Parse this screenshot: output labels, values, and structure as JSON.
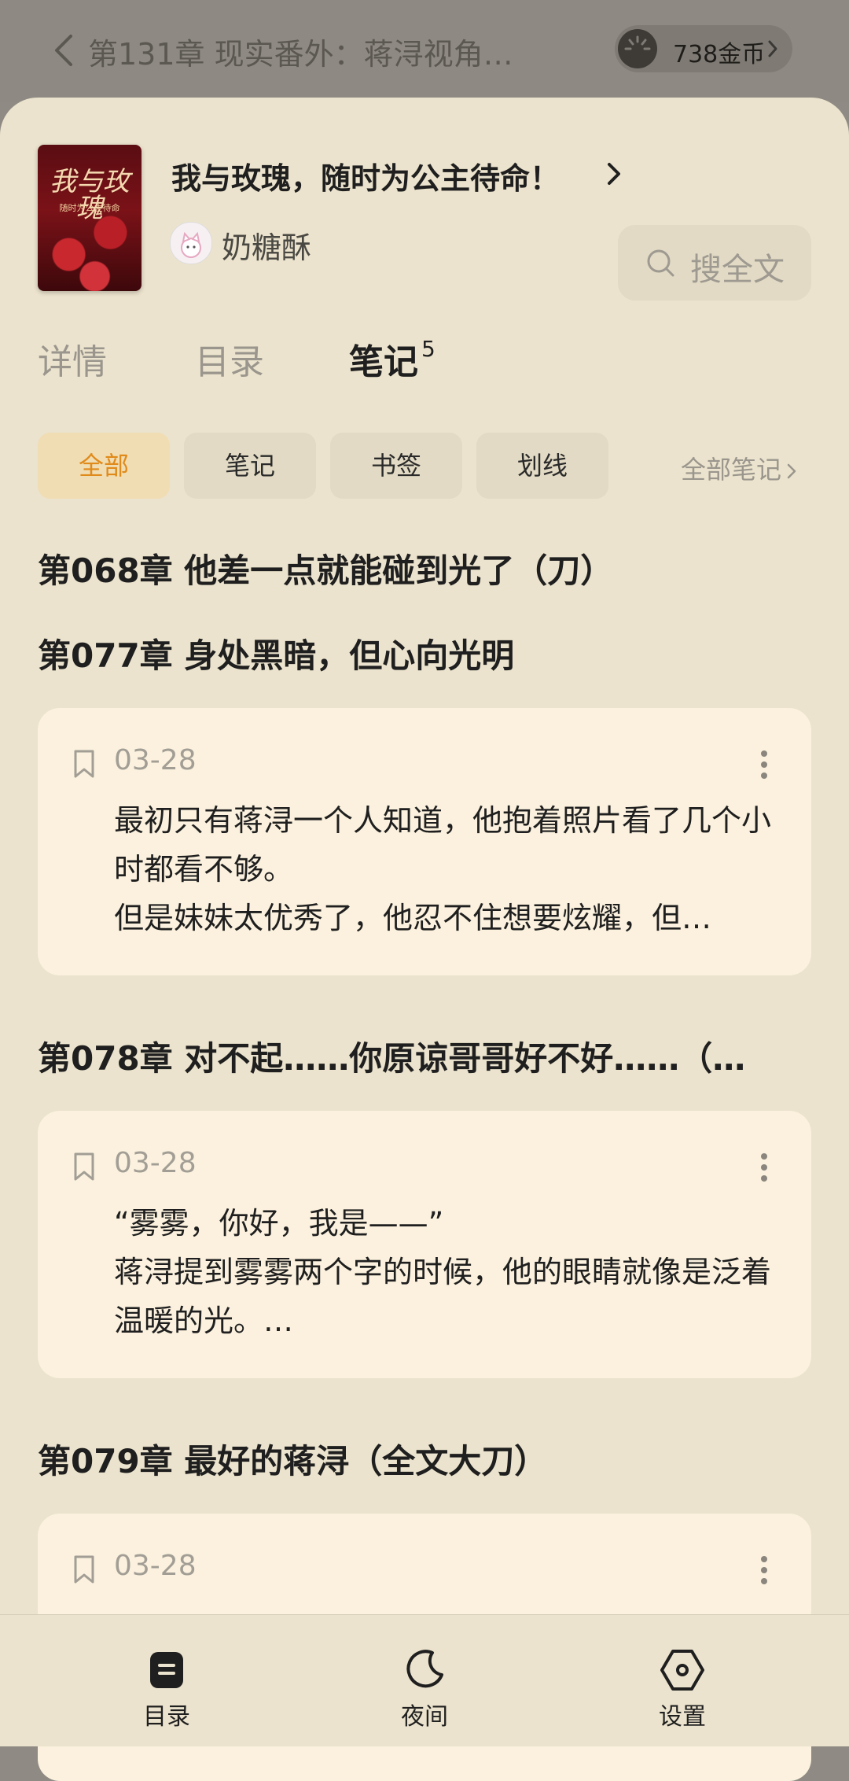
{
  "topbar": {
    "title": "第131章 现实番外：蒋浔视角…",
    "coins": "738金币"
  },
  "book": {
    "title": "我与玫瑰，随时为公主待命！",
    "author": "奶糖酥",
    "cover_title": "我与玫瑰",
    "cover_sub": "随时为公主待命"
  },
  "search": {
    "label": "搜全文"
  },
  "tabs": [
    {
      "label": "详情"
    },
    {
      "label": "目录"
    },
    {
      "label": "笔记",
      "count": "5"
    }
  ],
  "filters": [
    {
      "label": "全部",
      "active": true
    },
    {
      "label": "笔记"
    },
    {
      "label": "书签"
    },
    {
      "label": "划线"
    }
  ],
  "all_notes_label": "全部笔记",
  "chapters": [
    {
      "title": "第068章 他差一点就能碰到光了（刀）"
    },
    {
      "title": "第077章 身处黑暗，但心向光明"
    },
    {
      "title": "第078章 对不起……你原谅哥哥好不好……（…"
    },
    {
      "title": "第079章 最好的蒋浔（全文大刀）"
    }
  ],
  "notes": [
    {
      "date": "03-28",
      "text": "最初只有蒋浔一个人知道，他抱着照片看了几个小时都看不够。\n但是妹妹太优秀了，他忍不住想要炫耀，但…"
    },
    {
      "date": "03-28",
      "text": "“雾雾，你好，我是——”\n蒋浔提到雾雾两个字的时候，他的眼睛就像是泛着温暖的光。…"
    },
    {
      "date": "03-28",
      "text": ""
    }
  ],
  "bottom_nav": [
    {
      "label": "目录",
      "icon": "catalog-icon"
    },
    {
      "label": "夜间",
      "icon": "moon-icon"
    },
    {
      "label": "设置",
      "icon": "settings-icon"
    }
  ],
  "colors": {
    "accent": "#e08a1a",
    "sheet": "#ebe3cd",
    "card": "#fbf1de"
  }
}
